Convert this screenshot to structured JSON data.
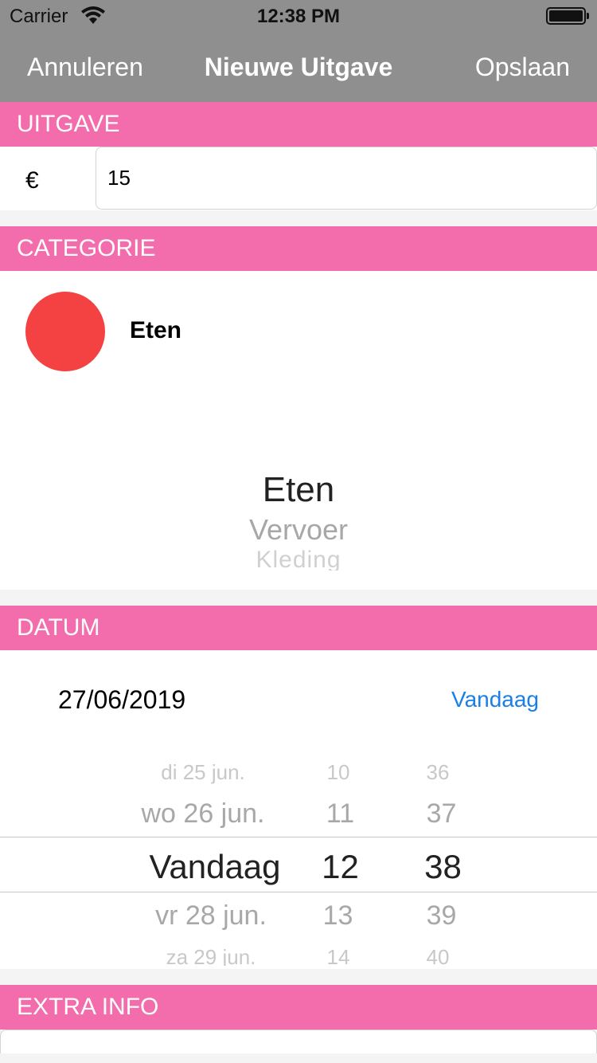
{
  "status": {
    "carrier": "Carrier",
    "time": "12:38 PM"
  },
  "nav": {
    "cancel": "Annuleren",
    "title": "Nieuwe Uitgave",
    "save": "Opslaan"
  },
  "expense": {
    "header": "UITGAVE",
    "currency": "€",
    "amount": "15"
  },
  "category": {
    "header": "CATEGORIE",
    "selected_name": "Eten",
    "selected_color": "#f44242",
    "picker": [
      "Eten",
      "Vervoer",
      "Kleding"
    ]
  },
  "date": {
    "header": "DATUM",
    "value": "27/06/2019",
    "today_button": "Vandaag",
    "wheel_days": [
      "di 25 jun.",
      "wo 26 jun.",
      "Vandaag",
      "vr 28 jun.",
      "za 29 jun."
    ],
    "wheel_hours": [
      "10",
      "11",
      "12",
      "13",
      "14"
    ],
    "wheel_minutes": [
      "36",
      "37",
      "38",
      "39",
      "40"
    ]
  },
  "extra": {
    "header": "EXTRA INFO"
  },
  "colors": {
    "nav_bg": "#8f8f8f",
    "section_header": "#f36dac",
    "link": "#1a7fe6"
  }
}
